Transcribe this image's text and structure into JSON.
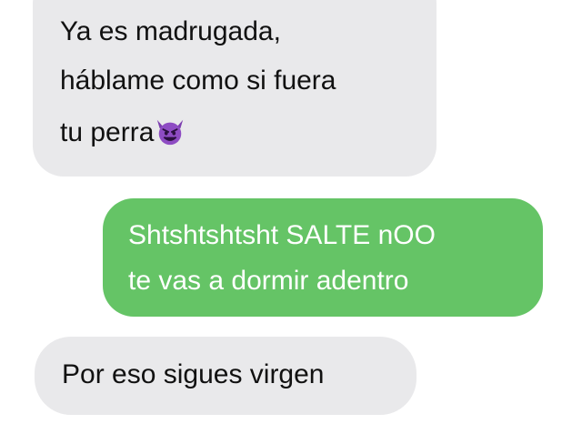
{
  "messages": [
    {
      "direction": "incoming",
      "lines": [
        "Ya es madrugada,",
        "háblame como si fuera",
        "tu perra"
      ],
      "emoji": "smiling-imp"
    },
    {
      "direction": "outgoing",
      "lines": [
        "Shtshtshtsht SALTE nOO",
        "te vas a dormir adentro"
      ]
    },
    {
      "direction": "incoming",
      "lines": [
        "Por eso sigues virgen"
      ]
    }
  ],
  "colors": {
    "background": "#ffffff",
    "incoming_bubble": "#e9e9eb",
    "incoming_text": "#111111",
    "outgoing_bubble": "#65c466",
    "outgoing_text": "#ffffff",
    "emoji_purple": "#7d3fb0"
  }
}
